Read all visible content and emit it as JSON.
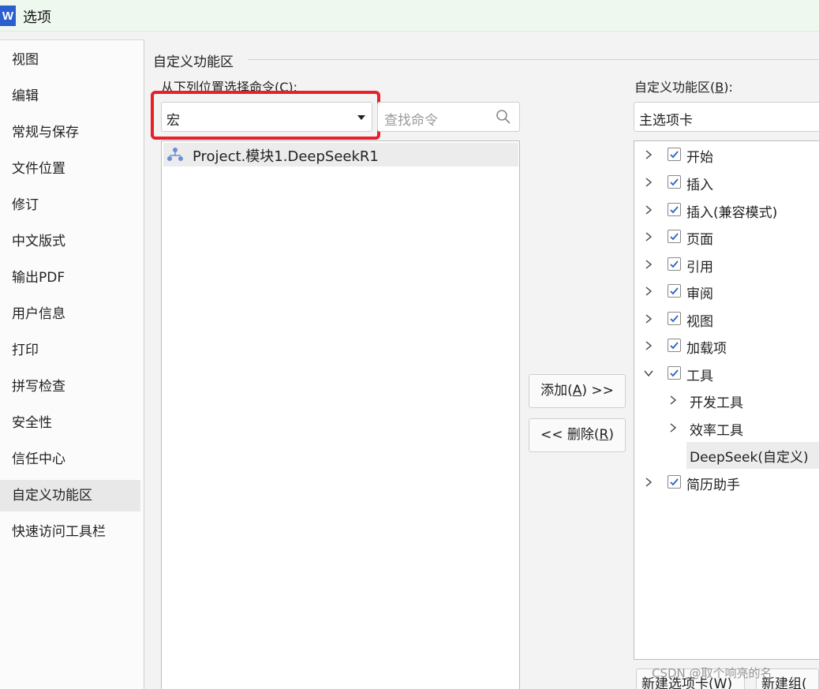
{
  "window": {
    "app_icon_letter": "W",
    "title": "选项"
  },
  "sidebar": {
    "items": [
      {
        "label": "视图"
      },
      {
        "label": "编辑"
      },
      {
        "label": "常规与保存"
      },
      {
        "label": "文件位置"
      },
      {
        "label": "修订"
      },
      {
        "label": "中文版式"
      },
      {
        "label": "输出PDF"
      },
      {
        "label": "用户信息"
      },
      {
        "label": "打印"
      },
      {
        "label": "拼写检查"
      },
      {
        "label": "安全性"
      },
      {
        "label": "信任中心"
      },
      {
        "label": "自定义功能区"
      },
      {
        "label": "快速访问工具栏"
      }
    ],
    "active_index": 12
  },
  "main": {
    "group_title": "自定义功能区",
    "choose_from": {
      "label_pre": "从下列位置选择命令(",
      "label_key": "C",
      "label_post": "):"
    },
    "source_select": {
      "value": "宏"
    },
    "search": {
      "placeholder": "查找命令"
    },
    "commands": [
      {
        "label": "Project.模块1.DeepSeekR1"
      }
    ],
    "add_button": {
      "pre": "添加(",
      "key": "A",
      "post": ") >>"
    },
    "remove_button": {
      "pre": "<< 删除(",
      "key": "R",
      "post": ")"
    },
    "customize_label": {
      "pre": "自定义功能区(",
      "key": "B",
      "post": "):"
    },
    "ribbon_select": {
      "value": "主选项卡"
    },
    "tree": [
      {
        "label": "开始"
      },
      {
        "label": "插入"
      },
      {
        "label": "插入(兼容模式)"
      },
      {
        "label": "页面"
      },
      {
        "label": "引用"
      },
      {
        "label": "审阅"
      },
      {
        "label": "视图"
      },
      {
        "label": "加载项"
      },
      {
        "label": "工具",
        "expanded": true
      },
      {
        "label": "开发工具",
        "level": 1
      },
      {
        "label": "效率工具",
        "level": 1
      },
      {
        "label": "DeepSeek(自定义)",
        "level": 1,
        "leaf": true
      },
      {
        "label": "简历助手"
      }
    ],
    "new_tab_button": "新建选项卡(W)",
    "new_group_button": "新建组(",
    "watermark": "CSDN @取个响亮的名"
  },
  "colors": {
    "highlight": "#e8202a",
    "accent": "#2b5fce",
    "checkmark": "#2a64c8"
  }
}
